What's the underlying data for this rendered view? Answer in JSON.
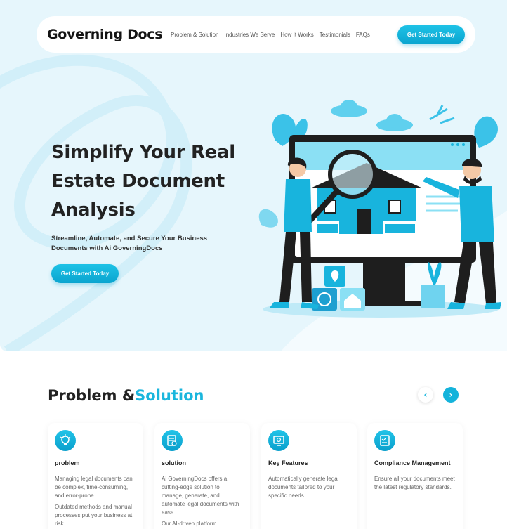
{
  "brand": {
    "logo": "Governing Docs",
    "accent_color": "#1ab6dd"
  },
  "nav": {
    "links": [
      "Problem & Solution",
      "Industries We Serve",
      "How It Works",
      "Testimonials",
      "FAQs"
    ],
    "cta": "Get Started Today"
  },
  "hero": {
    "title": "Simplify Your Real Estate Document Analysis",
    "subtitle": "Streamline, Automate, and Secure Your Business Documents with Ai GoverningDocs",
    "cta": "Get Started Today",
    "illustration": "real-estate-document-analysis-illustration"
  },
  "section": {
    "title_part1": "Problem &",
    "title_part2": "Solution",
    "prev_icon": "chevron-left-icon",
    "next_icon": "chevron-right-icon"
  },
  "cards": [
    {
      "icon": "idea-bulb-icon",
      "title": "problem",
      "paragraphs": [
        "Managing legal documents can be complex, time-consuming, and error-prone.",
        "Outdated methods and manual processes put your business at risk"
      ]
    },
    {
      "icon": "document-settings-icon",
      "title": "solution",
      "paragraphs": [
        "Ai GoverningDocs offers a cutting-edge solution to manage, generate, and automate legal documents with ease.",
        "Our AI-driven platform"
      ]
    },
    {
      "icon": "monitor-gear-icon",
      "title": "Key Features",
      "paragraphs": [
        "Automatically generate legal documents tailored to your specific needs."
      ]
    },
    {
      "icon": "compliance-checklist-icon",
      "title": "Compliance Management",
      "paragraphs": [
        "Ensure all your documents meet the latest regulatory standards."
      ]
    }
  ]
}
